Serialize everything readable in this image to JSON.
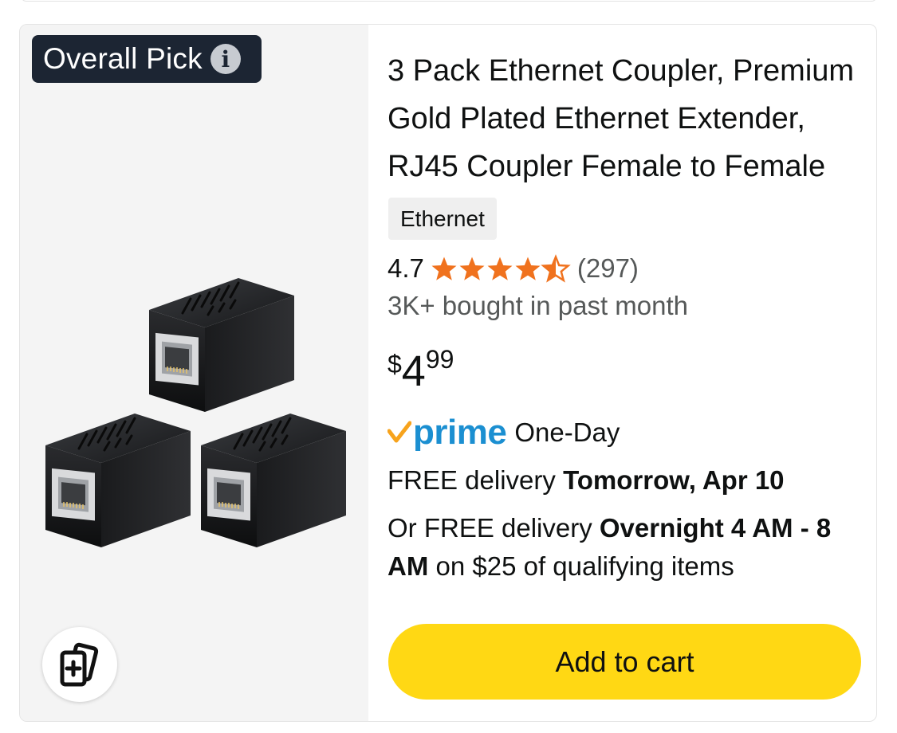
{
  "badge": {
    "label": "Overall Pick",
    "info_icon": "info-icon"
  },
  "product": {
    "title": "3 Pack Ethernet Coupler, Premium Gold Plated Ethernet Extender, RJ45 Coupler Female to Female",
    "tag": "Ethernet",
    "rating": {
      "value": "4.7",
      "stars": 4.5,
      "count": "(297)"
    },
    "bought": "3K+ bought in past month",
    "price": {
      "symbol": "$",
      "whole": "4",
      "fraction": "99"
    },
    "prime": {
      "word": "prime",
      "type": "One-Day"
    },
    "delivery": {
      "prefix": "FREE delivery ",
      "date": "Tomorrow, Apr 10"
    },
    "alt_delivery": {
      "prefix": "Or FREE delivery ",
      "window": "Overnight 4 AM - 8 AM",
      "suffix": " on $25 of qualifying items"
    },
    "add_to_cart": "Add to cart"
  },
  "colors": {
    "badge_bg": "#1c2533",
    "star": "#f0721e",
    "prime_blue": "#1b8fd1",
    "prime_check": "#f7a31c",
    "cart_button": "#ffd814"
  }
}
